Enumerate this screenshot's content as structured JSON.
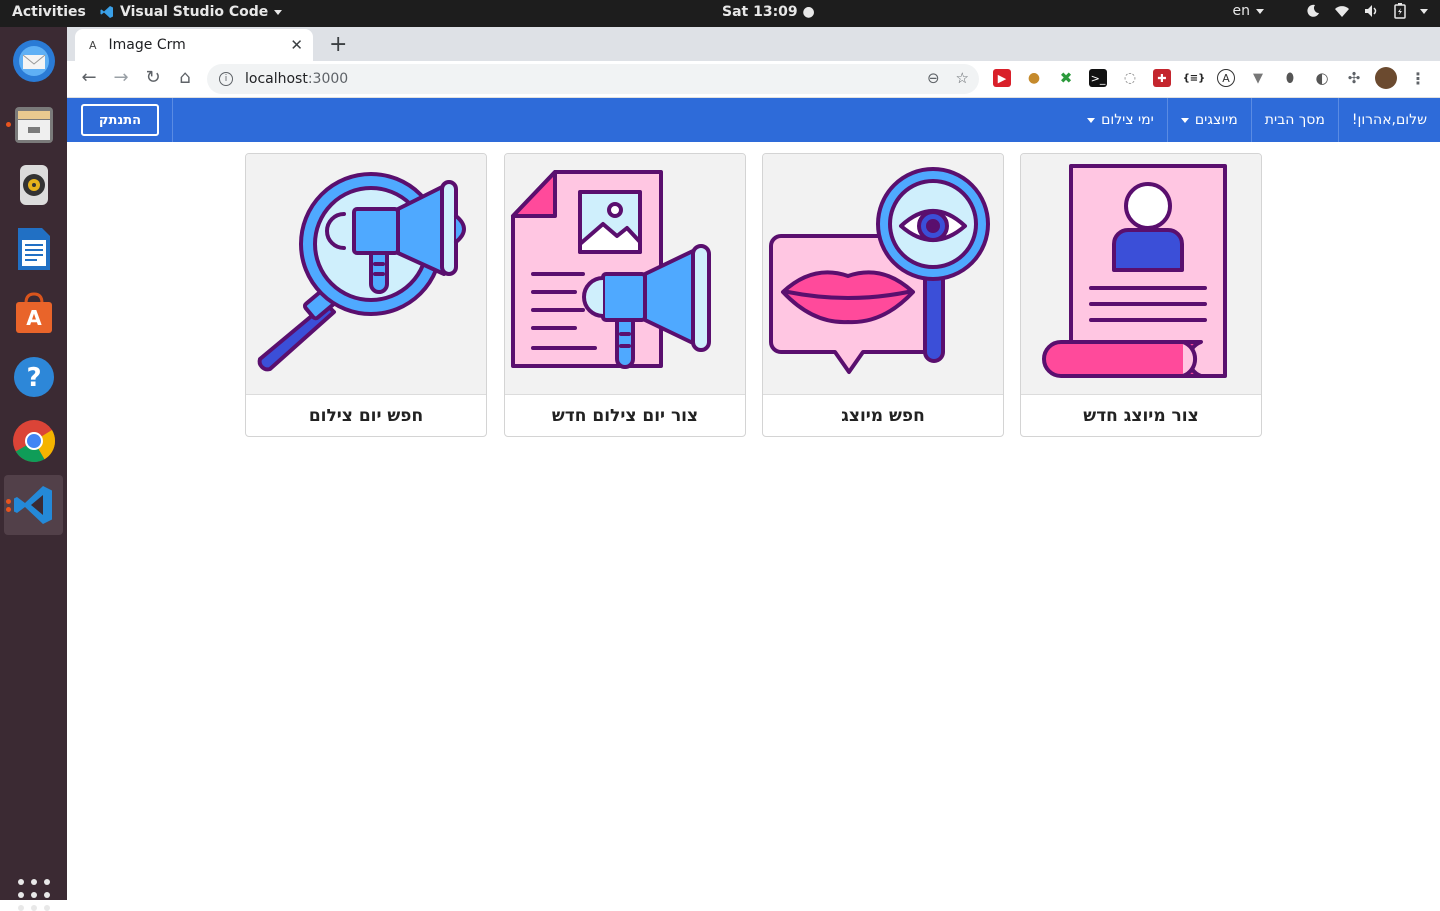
{
  "system": {
    "activities": "Activities",
    "app_name": "Visual Studio Code",
    "clock": "Sat 13:09 ●",
    "lang": "en"
  },
  "browser": {
    "tab_title": "Image Crm",
    "tab_favicon": "A",
    "url_host": "localhost",
    "url_port": ":3000"
  },
  "navbar": {
    "greeting": "שלום,אהרון!",
    "home": "מסך הבית",
    "models": "מיוצגים",
    "shoot_days": "ימי צילום",
    "logout": "התנתק"
  },
  "cards": [
    {
      "label": "צור מיוצג חדש",
      "icon": "resume-profile-icon"
    },
    {
      "label": "חפש מיוצג",
      "icon": "search-lips-icon"
    },
    {
      "label": "צור יום צילום חדש",
      "icon": "document-megaphone-icon"
    },
    {
      "label": "חפש יום צילום",
      "icon": "search-megaphone-icon"
    }
  ],
  "colors": {
    "navbar": "#2e6bd9",
    "pink": "#ffc6e2",
    "hotpink": "#ff4a9b",
    "blue": "#4fa9ff",
    "darkblue": "#3b4fd8",
    "outline": "#5a0f6e"
  }
}
